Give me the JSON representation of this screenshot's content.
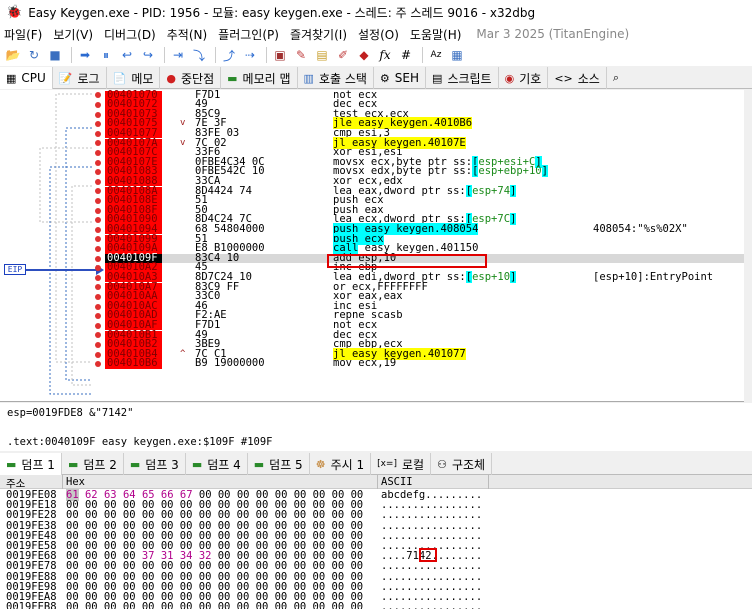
{
  "window": {
    "title": "Easy Keygen.exe - PID: 1956 - 모듈: easy keygen.exe - 스레드: 주 스레드 9016 - x32dbg"
  },
  "menu": {
    "items": [
      "파일(F)",
      "보기(V)",
      "디버그(D)",
      "추적(N)",
      "플러그인(P)",
      "즐겨찾기(I)",
      "설정(O)",
      "도움말(H)"
    ],
    "date": "Mar 3 2025 (TitanEngine)"
  },
  "tabs": [
    "CPU",
    "로그",
    "메모",
    "중단점",
    "메모리 맵",
    "호출 스택",
    "SEH",
    "스크립트",
    "기호",
    "소스"
  ],
  "disasm": {
    "rows": [
      {
        "addr": "00401070",
        "bytes": "F7D1",
        "instr": "not ecx"
      },
      {
        "addr": "00401072",
        "bytes": "49",
        "instr": "dec ecx"
      },
      {
        "addr": "00401073",
        "bytes": "85C9",
        "instr": "test ecx,ecx"
      },
      {
        "addr": "00401075",
        "bytes": "7E 3F",
        "instr": "jle easy keygen.4010B6",
        "mark": "v"
      },
      {
        "addr": "00401077",
        "bytes": "83FE 03",
        "instr": "cmp esi,3"
      },
      {
        "addr": "0040107A",
        "bytes": "7C 02",
        "instr": "jl easy keygen.40107E",
        "mark": "v"
      },
      {
        "addr": "0040107C",
        "bytes": "33F6",
        "instr": "xor esi,esi"
      },
      {
        "addr": "0040107E",
        "bytes": "0FBE4C34 0C",
        "instr": "movsx ecx,byte ptr ss:[esp+esi+C]"
      },
      {
        "addr": "00401083",
        "bytes": "0FBE542C 10",
        "instr": "movsx edx,byte ptr ss:[esp+ebp+10]"
      },
      {
        "addr": "00401088",
        "bytes": "33CA",
        "instr": "xor ecx,edx"
      },
      {
        "addr": "0040108A",
        "bytes": "8D4424 74",
        "instr": "lea eax,dword ptr ss:[esp+74]"
      },
      {
        "addr": "0040108E",
        "bytes": "51",
        "instr": "push ecx"
      },
      {
        "addr": "0040108F",
        "bytes": "50",
        "instr": "push eax"
      },
      {
        "addr": "00401090",
        "bytes": "8D4C24 7C",
        "instr": "lea ecx,dword ptr ss:[esp+7C]"
      },
      {
        "addr": "00401094",
        "bytes": "68 54804000",
        "instr": "push easy keygen.408054",
        "comment": "408054:\"%s%02X\""
      },
      {
        "addr": "00401099",
        "bytes": "51",
        "instr": "push ecx"
      },
      {
        "addr": "0040109A",
        "bytes": "E8 B1000000",
        "instr": "call easy keygen.401150"
      },
      {
        "addr": "0040109F",
        "bytes": "83C4 10",
        "instr": "add esp,10",
        "current": true
      },
      {
        "addr": "004010A2",
        "bytes": "45",
        "instr": "inc ebp"
      },
      {
        "addr": "004010A3",
        "bytes": "8D7C24 10",
        "instr": "lea edi,dword ptr ss:[esp+10]",
        "comment": "[esp+10]:EntryPoint"
      },
      {
        "addr": "004010A7",
        "bytes": "83C9 FF",
        "instr": "or ecx,FFFFFFFF"
      },
      {
        "addr": "004010AA",
        "bytes": "33C0",
        "instr": "xor eax,eax"
      },
      {
        "addr": "004010AC",
        "bytes": "46",
        "instr": "inc esi"
      },
      {
        "addr": "004010AD",
        "bytes": "F2:AE",
        "instr": "repne scasb"
      },
      {
        "addr": "004010AF",
        "bytes": "F7D1",
        "instr": "not ecx"
      },
      {
        "addr": "004010B1",
        "bytes": "49",
        "instr": "dec ecx"
      },
      {
        "addr": "004010B2",
        "bytes": "3BE9",
        "instr": "cmp ebp,ecx"
      },
      {
        "addr": "004010B4",
        "bytes": "7C C1",
        "instr": "jl easy keygen.401077",
        "mark": "^"
      },
      {
        "addr": "004010B6",
        "bytes": "B9 19000000",
        "instr": "mov ecx,19"
      }
    ],
    "eip_label": "EIP"
  },
  "info": {
    "line1": "esp=0019FDE8 &\"7142\"",
    "line2": ".text:0040109F easy keygen.exe:$109F #109F"
  },
  "dump_tabs": [
    "덤프 1",
    "덤프 2",
    "덤프 3",
    "덤프 4",
    "덤프 5",
    "주시 1",
    "로컬",
    "구조체"
  ],
  "dump": {
    "headers": {
      "addr": "주소",
      "hex": "Hex",
      "ascii": "ASCII"
    },
    "rows": [
      {
        "addr": "0019FE08",
        "hex": "61 62 63 64 65 66 67 00 00 00 00 00 00 00 00 00",
        "ascii": "abcdefg........."
      },
      {
        "addr": "0019FE18",
        "hex": "00 00 00 00 00 00 00 00 00 00 00 00 00 00 00 00",
        "ascii": "................"
      },
      {
        "addr": "0019FE28",
        "hex": "00 00 00 00 00 00 00 00 00 00 00 00 00 00 00 00",
        "ascii": "................"
      },
      {
        "addr": "0019FE38",
        "hex": "00 00 00 00 00 00 00 00 00 00 00 00 00 00 00 00",
        "ascii": "................"
      },
      {
        "addr": "0019FE48",
        "hex": "00 00 00 00 00 00 00 00 00 00 00 00 00 00 00 00",
        "ascii": "................"
      },
      {
        "addr": "0019FE58",
        "hex": "00 00 00 00 00 00 00 00 00 00 00 00 00 00 00 00",
        "ascii": "................"
      },
      {
        "addr": "0019FE68",
        "hex": "00 00 00 00 37 31 34 32 00 00 00 00 00 00 00 00",
        "ascii": "....7142........"
      },
      {
        "addr": "0019FE78",
        "hex": "00 00 00 00 00 00 00 00 00 00 00 00 00 00 00 00",
        "ascii": "................"
      },
      {
        "addr": "0019FE88",
        "hex": "00 00 00 00 00 00 00 00 00 00 00 00 00 00 00 00",
        "ascii": "................"
      },
      {
        "addr": "0019FE98",
        "hex": "00 00 00 00 00 00 00 00 00 00 00 00 00 00 00 00",
        "ascii": "................"
      },
      {
        "addr": "0019FEA8",
        "hex": "00 00 00 00 00 00 00 00 00 00 00 00 00 00 00 00",
        "ascii": "................"
      },
      {
        "addr": "0019FEB8",
        "hex": "00 00 00 00 00 00 00 00 00 00 00 00 00 00 00 00",
        "ascii": "................"
      }
    ]
  },
  "colors": {
    "address_bg": "#ff0000",
    "highlight_jump": "#ffff00",
    "highlight_ss": "#00ffff",
    "annotation_box": "#e00000"
  }
}
